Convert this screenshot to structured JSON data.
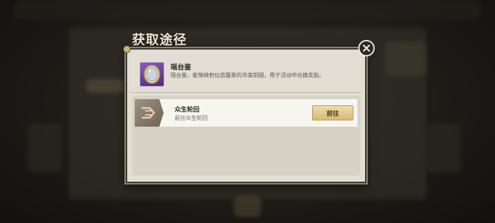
{
  "dialog": {
    "title": "获取途径",
    "item": {
      "name": "瑶台鉴",
      "description": "瑶台鉴，能够映射仙宫蜃景的华美铜镜，用于活动中兑换奖励。"
    },
    "sources": [
      {
        "name": "众生轮回",
        "subtitle": "前往众生轮回",
        "button_label": "前往"
      }
    ]
  },
  "icons": {
    "close": "close-icon",
    "item": "mirror-icon",
    "source": "cycle-emblem-icon"
  }
}
